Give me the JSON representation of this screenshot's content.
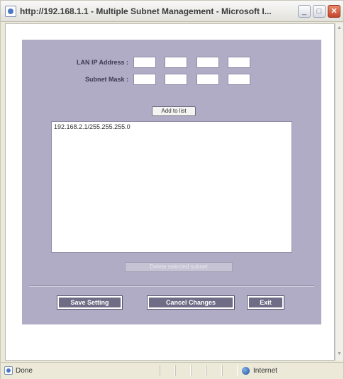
{
  "window": {
    "title": "http://192.168.1.1 - Multiple Subnet Management - Microsoft I...",
    "minimize_glyph": "_",
    "maximize_glyph": "□",
    "close_glyph": "✕"
  },
  "form": {
    "lan_ip_label": "LAN IP Address :",
    "subnet_mask_label": "Subnet Mask :",
    "lan_ip_octets": [
      "",
      "",
      "",
      ""
    ],
    "subnet_mask_octets": [
      "",
      "",
      "",
      ""
    ],
    "add_button": "Add to list",
    "subnet_list": [
      "192.168.2.1/255.255.255.0"
    ],
    "delete_button": "Delete selected subnet",
    "save_button": "Save Setting",
    "cancel_button": "Cancel Changes",
    "exit_button": "Exit"
  },
  "statusbar": {
    "status": "Done",
    "zone": "Internet"
  },
  "colors": {
    "panel": "#b0acc6",
    "action_button": "#6f6c86"
  }
}
